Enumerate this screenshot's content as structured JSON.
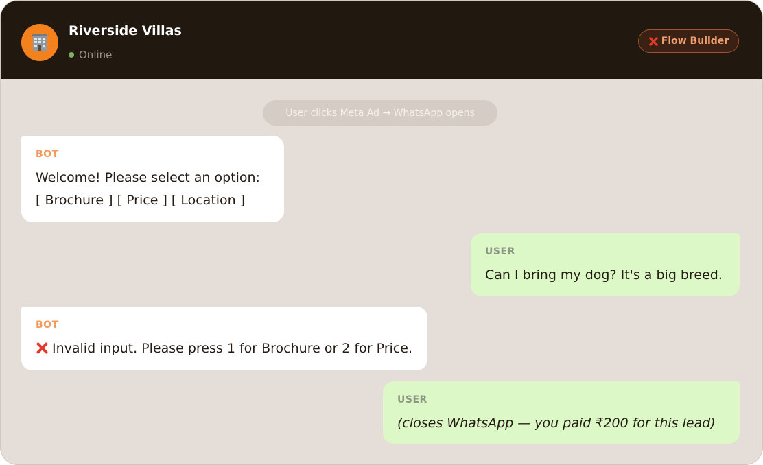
{
  "header": {
    "title": "Riverside Villas",
    "status": "Online",
    "avatar_icon": "building-icon",
    "avatar_color": "#f2811e",
    "flow_button": {
      "icon": "red-x-icon",
      "label": "Flow Builder"
    }
  },
  "chat": {
    "system_notice": "User clicks Meta Ad → WhatsApp opens",
    "messages": [
      {
        "sender": "BOT",
        "lines": [
          "Welcome! Please select an option:",
          "[ Brochure ] [ Price ] [ Location ]"
        ]
      },
      {
        "sender": "USER",
        "text": "Can I bring my dog? It's a big breed."
      },
      {
        "sender": "BOT",
        "icon": "red-x-icon",
        "text": "Invalid input. Please press 1 for Brochure or 2 for Price."
      },
      {
        "sender": "USER",
        "text": "(closes WhatsApp — you paid ₹200 for this lead)"
      }
    ]
  },
  "colors": {
    "header_bg": "#21180f",
    "chat_bg": "#e5ddd7",
    "bot_bubble": "#ffffff",
    "user_bubble": "#dcf8c6",
    "bot_label": "#f2995c",
    "user_label": "#8e9786",
    "online_dot": "#7fae62",
    "error_x": "#e23b2e"
  }
}
